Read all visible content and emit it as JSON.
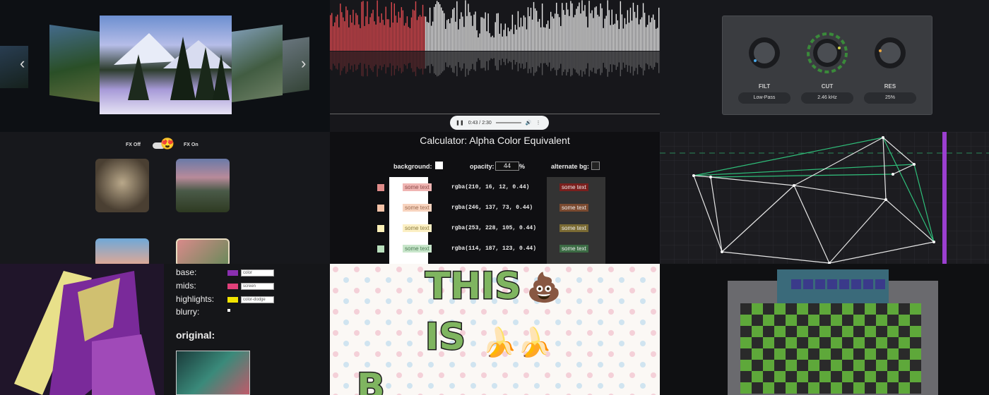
{
  "coverflow": {
    "prev_glyph": "‹",
    "next_glyph": "›"
  },
  "audio": {
    "time": "0:43 / 2:30",
    "progress": 0.29
  },
  "synth": {
    "knobs": [
      {
        "label": "FILT",
        "value": "Low-Pass",
        "accent": "#4aa8e8"
      },
      {
        "label": "CUT",
        "value": "2.46 kHz",
        "accent": "#6ad05a"
      },
      {
        "label": "RES",
        "value": "25%",
        "accent": "#e8a540"
      }
    ]
  },
  "fx_toggle": {
    "off_label": "FX Off",
    "on_label": "FX On",
    "emoji": "😍"
  },
  "calculator": {
    "title": "Calculator: Alpha Color Equivalent",
    "background_label": "background:",
    "opacity_label": "opacity:",
    "opacity_value": "44",
    "opacity_unit": "%",
    "alternate_label": "alternate bg:",
    "rows": [
      {
        "swatch": "#e08c8a",
        "sample_bg": "#f0b5b3",
        "sample_text": "some text",
        "rgba": "rgba(210, 16, 12, 0.44)",
        "alt_bg": "#7a1f1d"
      },
      {
        "swatch": "#f5c3a8",
        "sample_bg": "#f8d4bf",
        "sample_text": "some text",
        "rgba": "rgba(246, 137, 73, 0.44)",
        "alt_bg": "#7a4a30"
      },
      {
        "swatch": "#fdf0b8",
        "sample_bg": "#fcf0c4",
        "sample_text": "some text",
        "rgba": "rgba(253, 228, 105, 0.44)",
        "alt_bg": "#7a6a33"
      },
      {
        "swatch": "#b9dfbd",
        "sample_bg": "#c8e6cb",
        "sample_text": "some text",
        "rgba": "rgba(114, 187, 123, 0.44)",
        "alt_bg": "#3c6b44"
      }
    ]
  },
  "blend": {
    "rows": [
      {
        "label": "base:",
        "color": "#8a2fb0",
        "mode": "color"
      },
      {
        "label": "mids:",
        "color": "#e0407a",
        "mode": "screen"
      },
      {
        "label": "highlights:",
        "color": "#f2e400",
        "mode": "color-dodge"
      },
      {
        "label": "blurry:",
        "color": "",
        "mode": ""
      }
    ],
    "original_label": "original:"
  },
  "emoji_text": {
    "line1": "THIS",
    "line2": "IS",
    "line3": "B",
    "emoji1": "💩",
    "emoji2": "🍌🍌"
  }
}
